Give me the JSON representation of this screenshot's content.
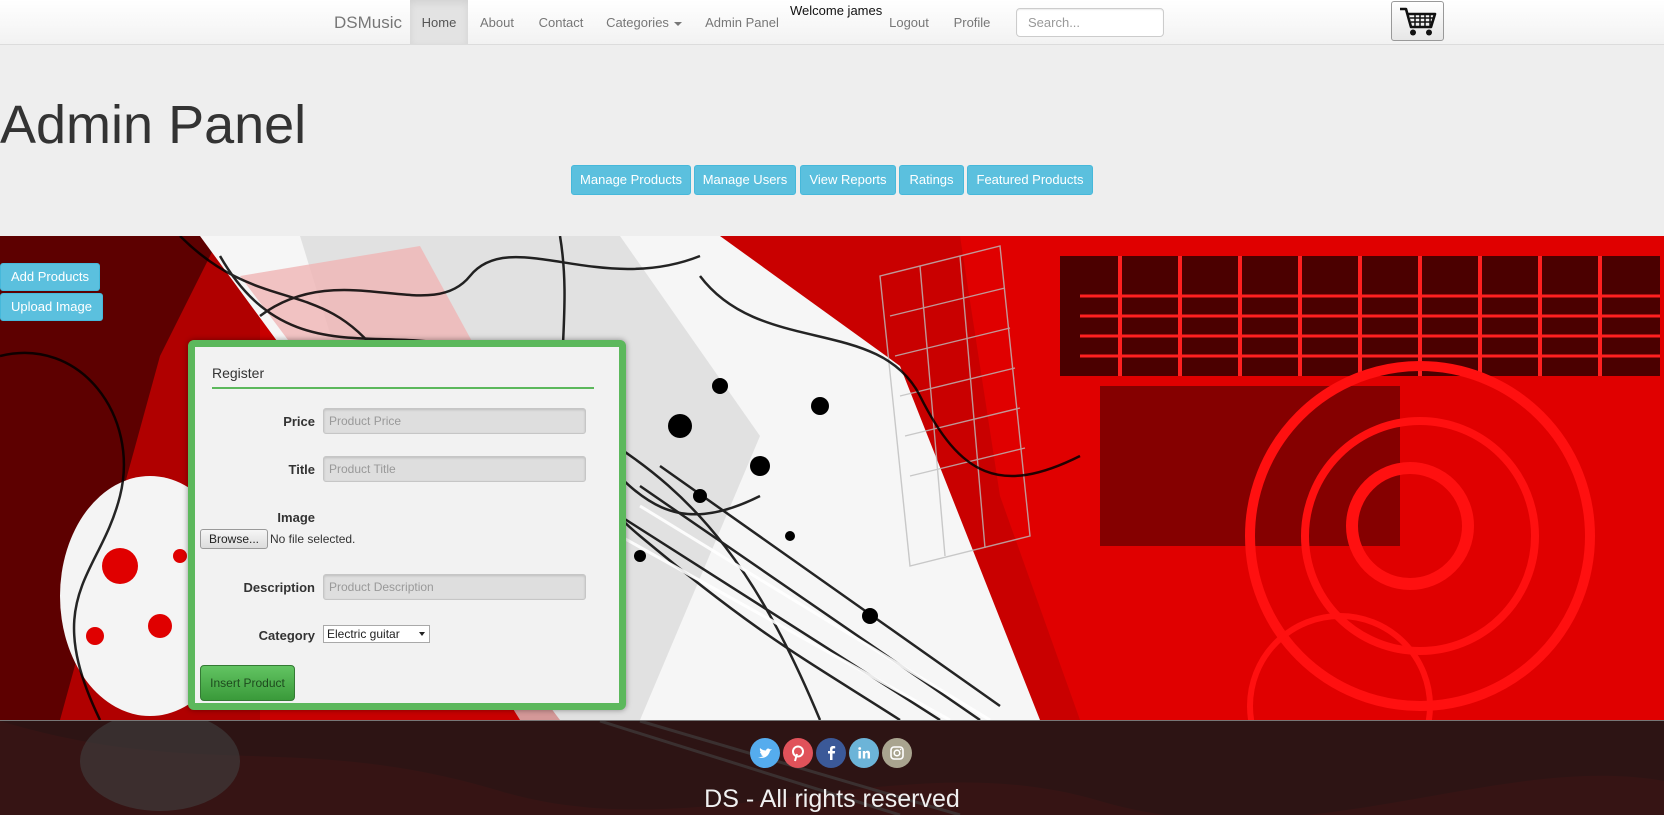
{
  "nav": {
    "brand": "DSMusic",
    "items": [
      {
        "label": "Home",
        "active": true
      },
      {
        "label": "About"
      },
      {
        "label": "Contact"
      },
      {
        "label": "Categories"
      },
      {
        "label": "Admin Panel"
      },
      {
        "label": "Logout"
      },
      {
        "label": "Profile"
      }
    ],
    "welcome": "Welcome james",
    "search_placeholder": "Search...",
    "cart_icon": "shopping-cart-icon"
  },
  "header": {
    "title": "Admin Panel",
    "buttons": [
      "Manage Products",
      "Manage Users",
      "View Reports",
      "Ratings",
      "Featured Products"
    ]
  },
  "sidebar": {
    "add_products": "Add Products",
    "upload_image": "Upload Image"
  },
  "form": {
    "legend": "Register",
    "price_label": "Price",
    "price_placeholder": "Product Price",
    "title_label": "Title",
    "title_placeholder": "Product Title",
    "image_label": "Image",
    "browse_label": "Browse...",
    "file_status": "No file selected.",
    "description_label": "Description",
    "description_placeholder": "Product Description",
    "category_label": "Category",
    "category_value": "Electric guitar",
    "submit_label": "Insert Product"
  },
  "footer": {
    "social": [
      {
        "icon": "twitter-icon",
        "color": "#55acee"
      },
      {
        "icon": "pinterest-icon",
        "color": "#e0525a"
      },
      {
        "icon": "facebook-icon",
        "color": "#3b5998"
      },
      {
        "icon": "linkedin-icon",
        "color": "#6cb4d8"
      },
      {
        "icon": "instagram-icon",
        "color": "#a9a48f"
      }
    ],
    "copyright": "DS - All rights reserved"
  },
  "colors": {
    "accent": "#5bc0de",
    "form_border": "#5cb85c",
    "hero_red": "#e00000"
  }
}
